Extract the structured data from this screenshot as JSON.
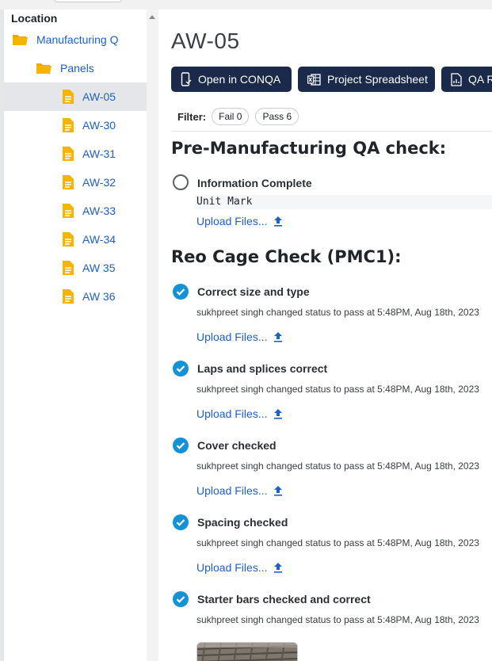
{
  "sidebar": {
    "title": "Location",
    "tree": [
      {
        "label": "Manufacturing Q",
        "kind": "folder",
        "level": 0
      },
      {
        "label": "Panels",
        "kind": "folder",
        "level": 1
      },
      {
        "label": "AW-05",
        "kind": "doc",
        "selected": true
      },
      {
        "label": "AW-30",
        "kind": "doc"
      },
      {
        "label": "AW-31",
        "kind": "doc"
      },
      {
        "label": "AW-32",
        "kind": "doc"
      },
      {
        "label": "AW-33",
        "kind": "doc"
      },
      {
        "label": "AW-34",
        "kind": "doc"
      },
      {
        "label": "AW 35",
        "kind": "doc"
      },
      {
        "label": "AW 36",
        "kind": "doc"
      }
    ]
  },
  "main": {
    "title": "AW-05",
    "buttons": [
      {
        "label": "Open in CONQA",
        "icon": "phone-check-icon"
      },
      {
        "label": "Project Spreadsheet",
        "icon": "excel-icon"
      },
      {
        "label": "QA R",
        "icon": "report-icon"
      }
    ],
    "filter": {
      "label": "Filter:",
      "fail": "Fail 0",
      "pass": "Pass 6"
    },
    "sections": [
      {
        "title": "Pre-Manufacturing QA check:",
        "items": [
          {
            "title": "Information Complete",
            "status": "unchecked",
            "field_value": "Unit Mark",
            "upload": "Upload Files..."
          }
        ]
      },
      {
        "title": "Reo Cage Check (PMC1):",
        "items": [
          {
            "title": "Correct size and type",
            "status": "pass",
            "note": "sukhpreet singh changed status to pass at 5:48PM, Aug 18th, 2023",
            "upload": "Upload Files..."
          },
          {
            "title": "Laps and splices correct",
            "status": "pass",
            "note": "sukhpreet singh changed status to pass at 5:48PM, Aug 18th, 2023",
            "upload": "Upload Files..."
          },
          {
            "title": "Cover checked",
            "status": "pass",
            "note": "sukhpreet singh changed status to pass at 5:48PM, Aug 18th, 2023",
            "upload": "Upload Files..."
          },
          {
            "title": "Spacing checked",
            "status": "pass",
            "note": "sukhpreet singh changed status to pass at 5:48PM, Aug 18th, 2023",
            "upload": "Upload Files..."
          },
          {
            "title": "Starter bars checked and correct",
            "status": "pass",
            "note": "sukhpreet singh changed status to pass at 5:48PM, Aug 18th, 2023"
          }
        ]
      }
    ]
  },
  "colors": {
    "accent_blue": "#1f5fc7",
    "button_bg": "#1b2a4a",
    "check_blue": "#1592d6",
    "folder_yellow": "#f5b400",
    "selected_bg": "#e4e6ea"
  }
}
